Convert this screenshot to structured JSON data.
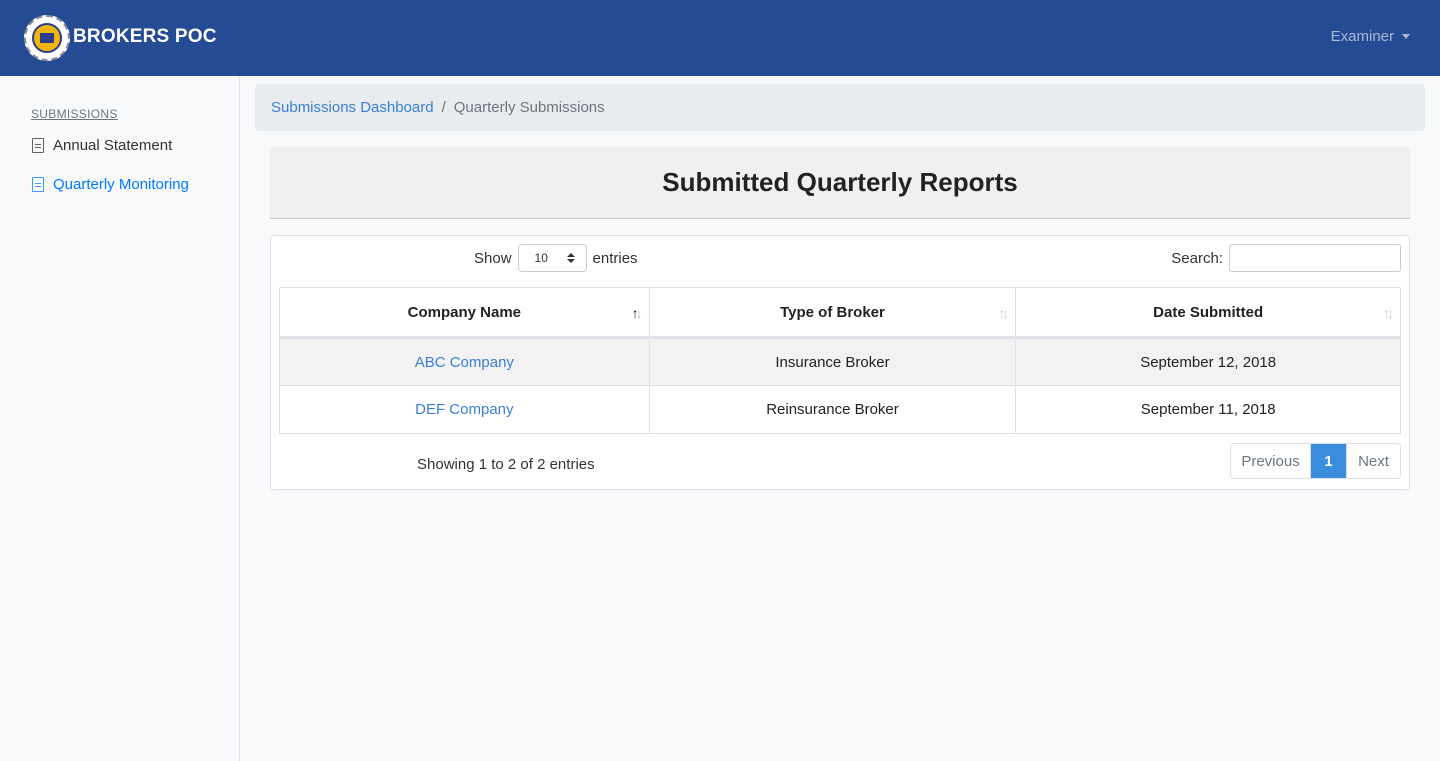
{
  "navbar": {
    "brand": "BROKERS POC",
    "user_menu": "Examiner",
    "colors": {
      "background": "#244b94",
      "text": "#ffffff"
    }
  },
  "sidebar": {
    "heading": "SUBMISSIONS",
    "items": [
      {
        "label": "Annual Statement",
        "icon": "document-icon",
        "active": false
      },
      {
        "label": "Quarterly Monitoring",
        "icon": "document-icon",
        "active": true
      }
    ]
  },
  "breadcrumb": {
    "link": "Submissions Dashboard",
    "separator": "/",
    "current": "Quarterly Submissions"
  },
  "main": {
    "title": "Submitted Quarterly Reports",
    "length_menu": {
      "prefix": "Show",
      "value": "10",
      "suffix": "entries"
    },
    "search": {
      "label": "Search:",
      "value": ""
    },
    "table": {
      "columns": [
        "Company Name",
        "Type of Broker",
        "Date Submitted"
      ],
      "rows": [
        [
          "ABC Company",
          "Insurance Broker",
          "September 12, 2018"
        ],
        [
          "DEF Company",
          "Reinsurance Broker",
          "September 11, 2018"
        ]
      ]
    },
    "info": "Showing 1 to 2 of 2 entries",
    "pagination": {
      "previous": "Previous",
      "current": "1",
      "next": "Next"
    },
    "colors": {
      "link": "#3a7fd5",
      "accent": "#3a8ddc"
    }
  }
}
